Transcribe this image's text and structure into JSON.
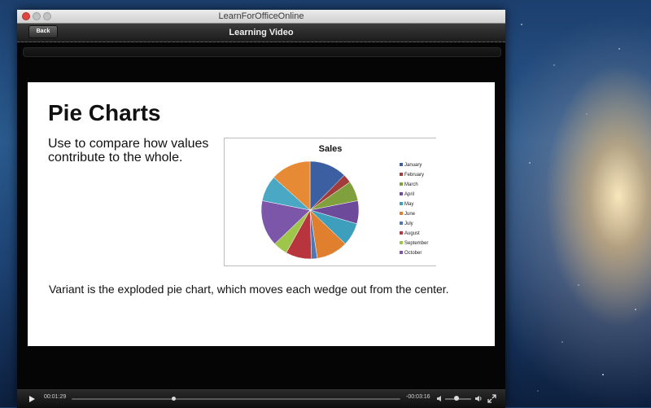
{
  "window": {
    "title": "LearnForOfficeOnline"
  },
  "navbar": {
    "title": "Learning Video",
    "back_label": "Back"
  },
  "slide": {
    "title": "Pie Charts",
    "description": "Use to compare how values contribute to the whole.",
    "footer": "Variant is the exploded pie chart, which moves each wedge out from the center."
  },
  "player": {
    "elapsed": "00:01:29",
    "remaining": "-00:03:16",
    "progress": 0.31,
    "volume": 0.45
  },
  "chart_data": {
    "type": "pie",
    "title": "Sales",
    "legend_position": "right",
    "categories": [
      "January",
      "February",
      "March",
      "April",
      "May",
      "June",
      "July",
      "August",
      "September",
      "October"
    ],
    "values": [
      13,
      3,
      7,
      8,
      8,
      11,
      2,
      9,
      5,
      16
    ],
    "colors": [
      "#3b5fa0",
      "#a23b3b",
      "#7fa03d",
      "#6e4a9a",
      "#3e9fbc",
      "#e07f2e",
      "#4f77b5",
      "#b8353d",
      "#9dc64a",
      "#7c56a8"
    ],
    "extra_slice_colors": [
      "#4aa8c4",
      "#e68a35"
    ],
    "extra_values": [
      9,
      14
    ]
  }
}
